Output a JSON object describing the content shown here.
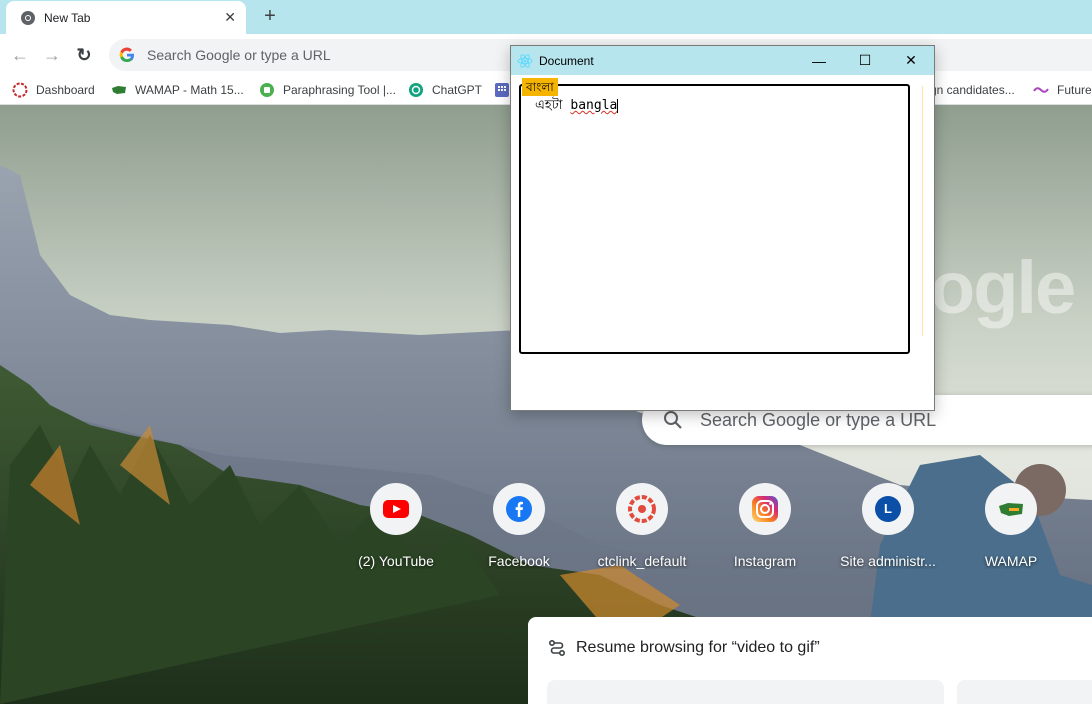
{
  "browser": {
    "tab": {
      "title": "New Tab",
      "close_glyph": "✕"
    },
    "new_tab_glyph": "+",
    "toolbar": {
      "back_glyph": "←",
      "forward_glyph": "→",
      "reload_glyph": "↻",
      "omnibox_placeholder": "Search Google or type a URL"
    },
    "bookmarks": [
      {
        "label": "Dashboard",
        "icon": "dashboard-icon"
      },
      {
        "label": "WAMAP - Math 15...",
        "icon": "wamap-icon"
      },
      {
        "label": "Paraphrasing Tool |...",
        "icon": "paraphrase-icon"
      },
      {
        "label": "ChatGPT",
        "icon": "chatgpt-icon"
      },
      {
        "label": "gn candidates...",
        "icon": ""
      },
      {
        "label": "Future",
        "icon": "future-icon"
      }
    ]
  },
  "ntp": {
    "logo_text": "ogle",
    "search_placeholder": "Search Google or type a URL",
    "shortcuts": [
      {
        "label": "(2) YouTube",
        "icon": "youtube-icon"
      },
      {
        "label": "Facebook",
        "icon": "facebook-icon"
      },
      {
        "label": "ctclink_default",
        "icon": "ctclink-icon"
      },
      {
        "label": "Instagram",
        "icon": "instagram-icon"
      },
      {
        "label": "Site administr...",
        "icon": "site-admin-icon",
        "letter": "L"
      },
      {
        "label": "WAMAP",
        "icon": "wamap-icon"
      }
    ],
    "resume": {
      "title": "Resume browsing for “video to gif”"
    }
  },
  "document_window": {
    "title": "Document",
    "minimize_glyph": "—",
    "maximize_glyph": "☐",
    "close_glyph": "✕",
    "language_badge": "বাংলা",
    "text_bangla": "এহটা",
    "text_latin": "bangla"
  },
  "colors": {
    "tabstrip": "#b6e5ee",
    "badge": "#f4b400",
    "spellcheck": "#d93025"
  }
}
